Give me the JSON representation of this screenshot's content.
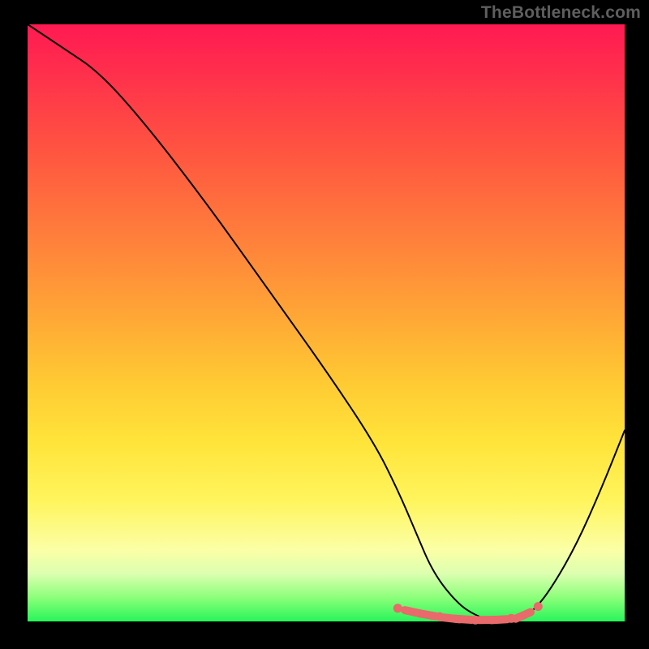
{
  "watermark": "TheBottleneck.com",
  "colors": {
    "frame_bg": "#000000",
    "gradient_top": "#ff1a52",
    "gradient_bottom": "#28f55a",
    "curve": "#000000",
    "markers": "#e86a6a",
    "watermark_text": "#5e5e5e"
  },
  "chart_data": {
    "type": "line",
    "title": "",
    "xlabel": "",
    "ylabel": "",
    "xlim": [
      0,
      100
    ],
    "ylim": [
      0,
      100
    ],
    "grid": false,
    "legend": false,
    "series": [
      {
        "name": "bottleneck-curve",
        "x": [
          0,
          6,
          12,
          20,
          30,
          40,
          50,
          58,
          62,
          65,
          68,
          72,
          75,
          78,
          80,
          82,
          85,
          88,
          92,
          96,
          100
        ],
        "y": [
          100,
          96,
          92,
          83,
          70,
          56,
          42,
          30,
          22,
          15,
          8,
          3,
          1,
          0,
          0,
          0,
          2,
          6,
          13,
          22,
          32
        ]
      }
    ],
    "markers": {
      "name": "optimal-band",
      "x": [
        62,
        64.5,
        67,
        69,
        71,
        73,
        75,
        77,
        79,
        81,
        83,
        85.5
      ],
      "y": [
        2.2,
        1.6,
        1.1,
        0.8,
        0.5,
        0.35,
        0.25,
        0.25,
        0.3,
        0.5,
        1.0,
        2.5
      ]
    }
  }
}
